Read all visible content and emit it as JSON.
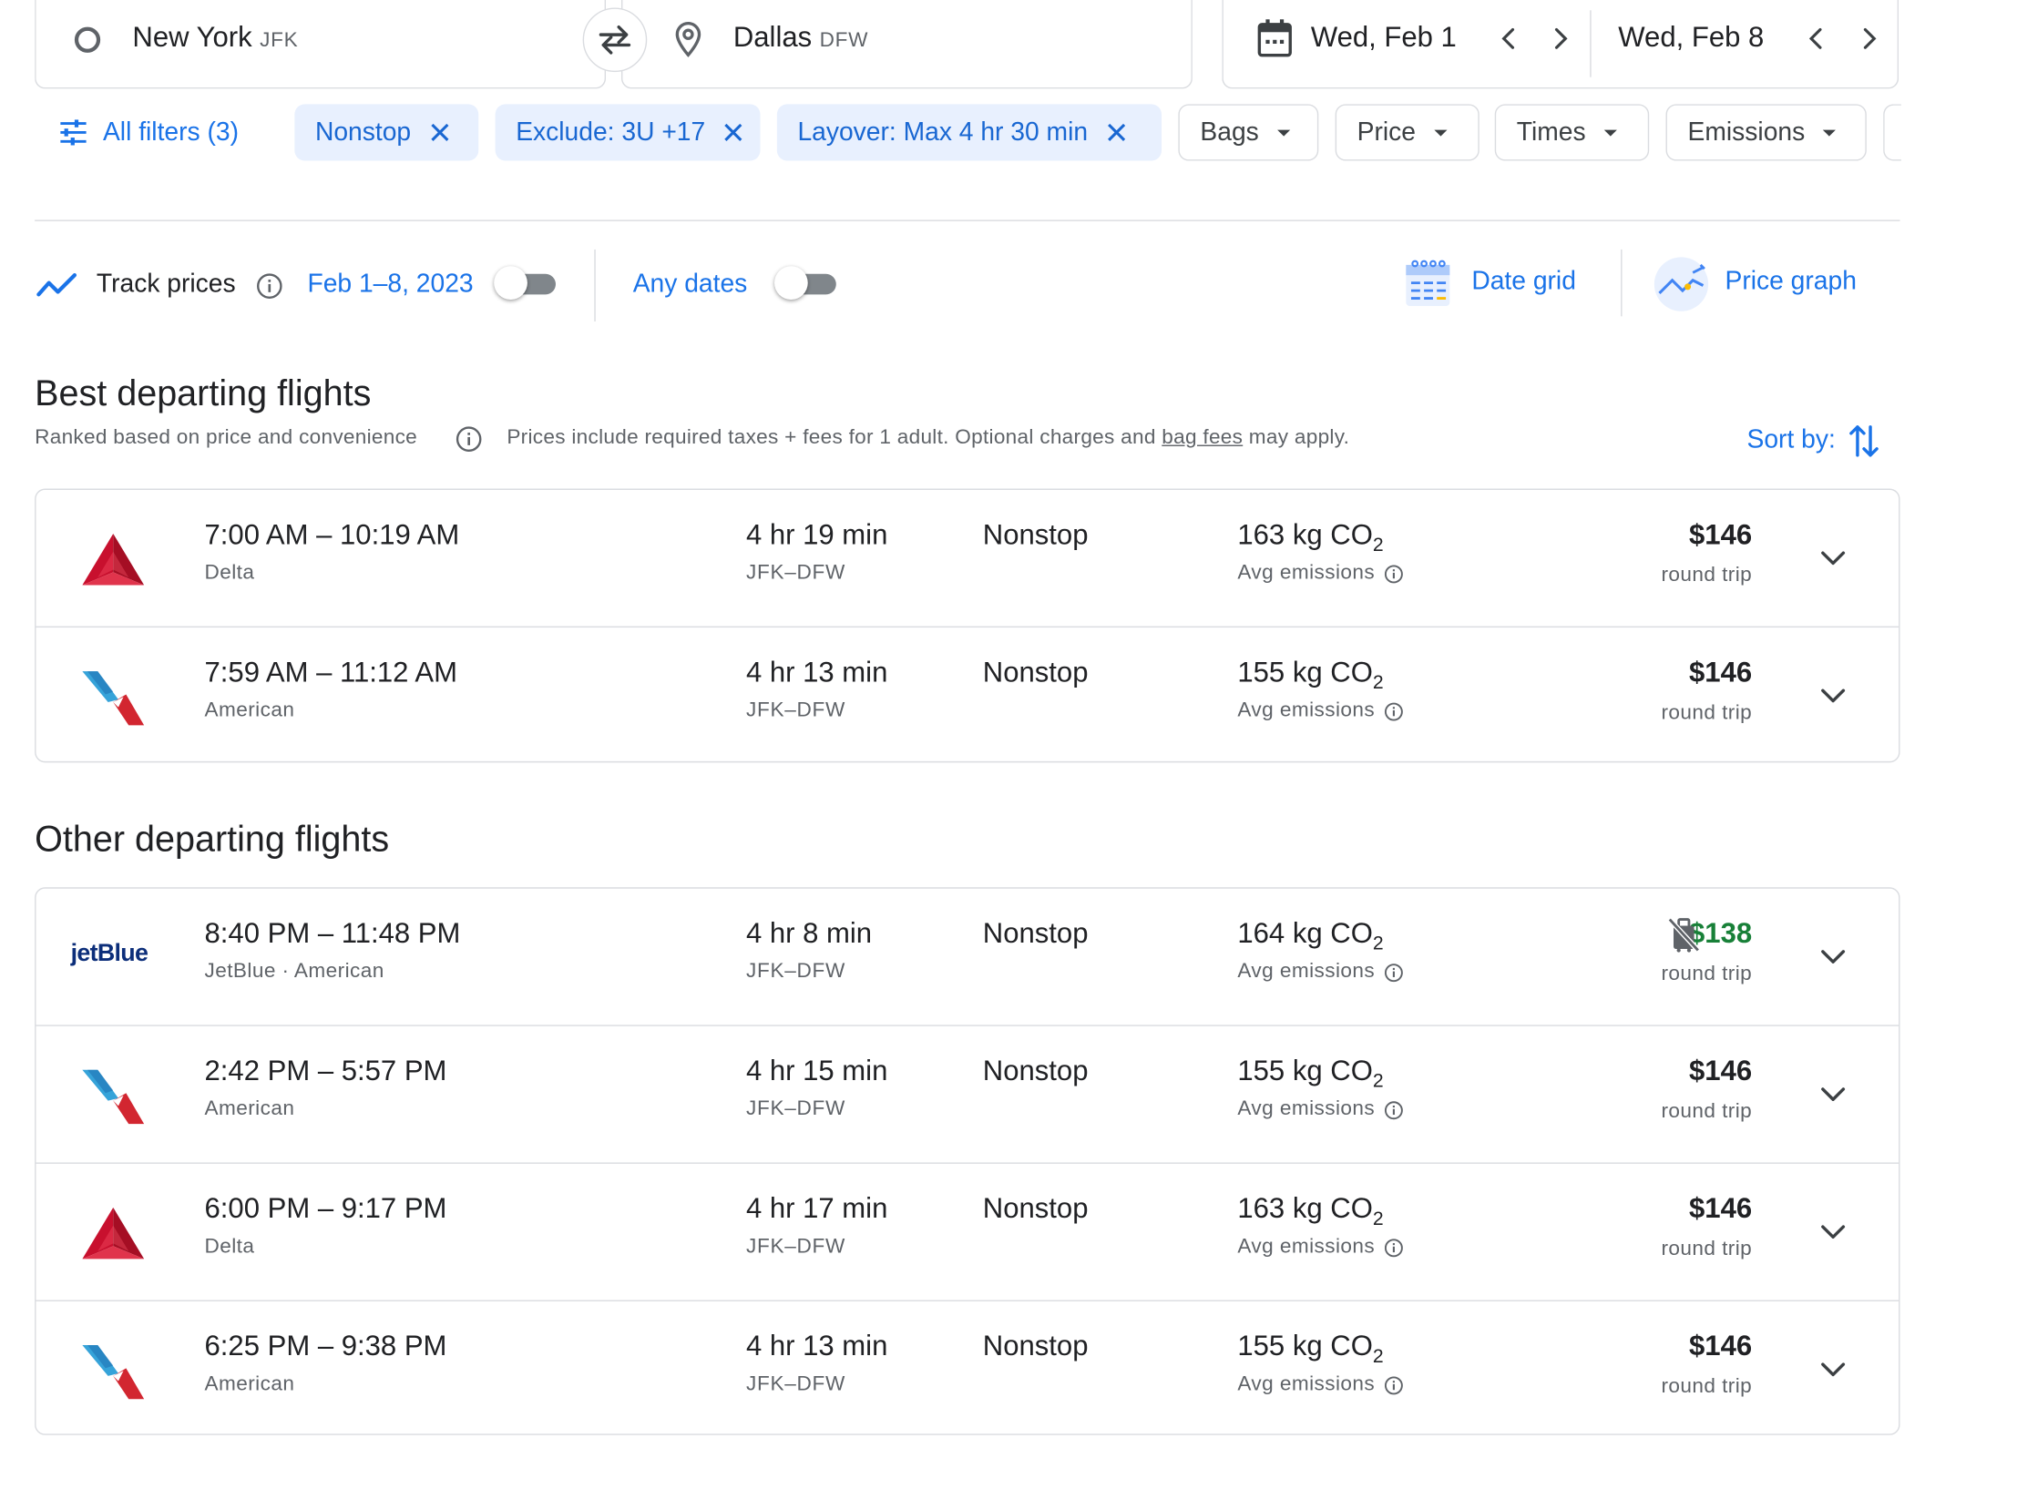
{
  "search": {
    "origin": "New York",
    "origin_code": "JFK",
    "destination": "Dallas",
    "destination_code": "DFW",
    "depart_date": "Wed, Feb 1",
    "return_date": "Wed, Feb 8"
  },
  "filters": {
    "all_filters": "All filters (3)",
    "active": [
      "Nonstop",
      "Exclude: 3U +17",
      "Layover: Max 4 hr 30 min"
    ],
    "dropdowns": [
      "Bags",
      "Price",
      "Times",
      "Emissions"
    ]
  },
  "tracking": {
    "track_label": "Track prices",
    "date_range": "Feb 1–8, 2023",
    "any_dates": "Any dates",
    "date_grid": "Date grid",
    "price_graph": "Price graph"
  },
  "best": {
    "title": "Best departing flights",
    "ranked": "Ranked based on price and convenience",
    "note_prefix": "Prices include required taxes + fees for 1 adult. Optional charges and",
    "note_link": "bag fees",
    "note_suffix": "may apply.",
    "sort_by": "Sort by:"
  },
  "other": {
    "title": "Other departing flights"
  },
  "labels": {
    "emission_unit": "kg CO",
    "emission_sub": "2",
    "avg_emissions": "Avg emissions",
    "round_trip": "round trip",
    "jetblue_logo": "jetBlue"
  },
  "flights_best": [
    {
      "airline_logo": "delta",
      "times": "7:00 AM – 10:19 AM",
      "airline": "Delta",
      "duration": "4 hr 19 min",
      "route": "JFK–DFW",
      "stops": "Nonstop",
      "emissions": "163",
      "price": "$146"
    },
    {
      "airline_logo": "american",
      "times": "7:59 AM – 11:12 AM",
      "airline": "American",
      "duration": "4 hr 13 min",
      "route": "JFK–DFW",
      "stops": "Nonstop",
      "emissions": "155",
      "price": "$146"
    }
  ],
  "flights_other": [
    {
      "airline_logo": "jetblue",
      "times": "8:40 PM – 11:48 PM",
      "airline": "JetBlue · American",
      "duration": "4 hr 8 min",
      "route": "JFK–DFW",
      "stops": "Nonstop",
      "emissions": "164",
      "price": "$138",
      "price_color": "#188038",
      "no_bag_icon": true
    },
    {
      "airline_logo": "american",
      "times": "2:42 PM – 5:57 PM",
      "airline": "American",
      "duration": "4 hr 15 min",
      "route": "JFK–DFW",
      "stops": "Nonstop",
      "emissions": "155",
      "price": "$146"
    },
    {
      "airline_logo": "delta",
      "times": "6:00 PM – 9:17 PM",
      "airline": "Delta",
      "duration": "4 hr 17 min",
      "route": "JFK–DFW",
      "stops": "Nonstop",
      "emissions": "163",
      "price": "$146"
    },
    {
      "airline_logo": "american",
      "times": "6:25 PM – 9:38 PM",
      "airline": "American",
      "duration": "4 hr 13 min",
      "route": "JFK–DFW",
      "stops": "Nonstop",
      "emissions": "155",
      "price": "$146"
    }
  ],
  "colors": {
    "accent": "#1a73e8",
    "chip_bg": "#e8f0fe",
    "chip_text": "#1967d2",
    "delta_red": "#c8102e",
    "american_blue": "#36a3d9",
    "jetblue_navy": "#0c2e7a"
  }
}
